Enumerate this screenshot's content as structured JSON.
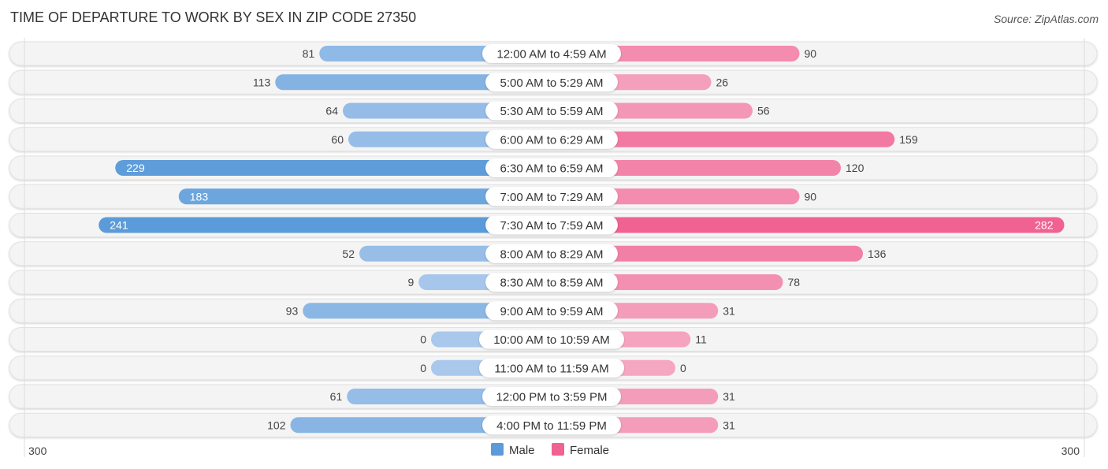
{
  "chart_data": {
    "type": "bar",
    "orientation": "horizontal-butterfly",
    "title": "TIME OF DEPARTURE TO WORK BY SEX IN ZIP CODE 27350",
    "source": "Source: ZipAtlas.com",
    "categories": [
      "12:00 AM to 4:59 AM",
      "5:00 AM to 5:29 AM",
      "5:30 AM to 5:59 AM",
      "6:00 AM to 6:29 AM",
      "6:30 AM to 6:59 AM",
      "7:00 AM to 7:29 AM",
      "7:30 AM to 7:59 AM",
      "8:00 AM to 8:29 AM",
      "8:30 AM to 8:59 AM",
      "9:00 AM to 9:59 AM",
      "10:00 AM to 10:59 AM",
      "11:00 AM to 11:59 AM",
      "12:00 PM to 3:59 PM",
      "4:00 PM to 11:59 PM"
    ],
    "series": [
      {
        "name": "Male",
        "color": "#5b9bd9",
        "light_color": "#a9c8ec",
        "side": "left",
        "values": [
          81,
          113,
          64,
          60,
          229,
          183,
          241,
          52,
          9,
          93,
          0,
          0,
          61,
          102
        ]
      },
      {
        "name": "Female",
        "color": "#f06292",
        "light_color": "#f5a6c0",
        "side": "right",
        "values": [
          90,
          26,
          56,
          159,
          120,
          90,
          282,
          136,
          78,
          31,
          11,
          0,
          31,
          31
        ]
      }
    ],
    "xlim": [
      300,
      300
    ],
    "axis_labels": {
      "left": "300",
      "right": "300"
    },
    "legend": {
      "position": "bottom-center",
      "entries": [
        "Male",
        "Female"
      ]
    },
    "grid": false
  }
}
